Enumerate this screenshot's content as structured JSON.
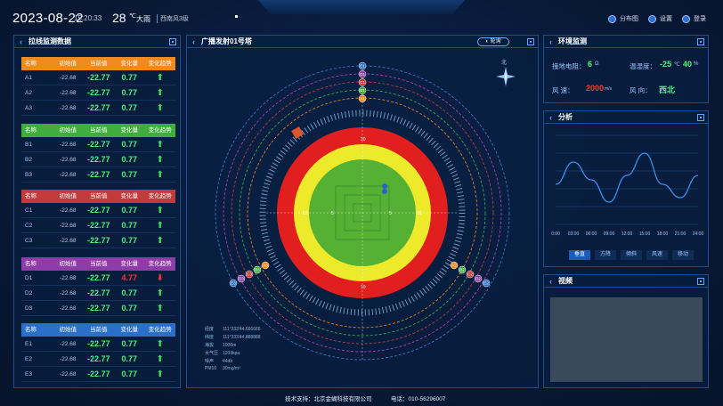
{
  "header": {
    "date": "2023-08-22",
    "time": "15:20:33",
    "temp": "28",
    "temp_unit": "℃",
    "weather": "大雨",
    "wind": "西南风3级",
    "buttons": [
      {
        "label": "分布图",
        "icon": "map-icon"
      },
      {
        "label": "设置",
        "icon": "gear-icon"
      },
      {
        "label": "登录",
        "icon": "user-icon"
      }
    ]
  },
  "left_panel": {
    "title": "拉线监测数据",
    "columns": [
      "名称",
      "初始值",
      "当前值",
      "变化量",
      "变化趋势"
    ],
    "groups": [
      {
        "color": "#f08a1f",
        "rows": [
          {
            "name": "A1",
            "init": "-22.68",
            "cur": "-22.77",
            "delta": "0.77",
            "trend": "up"
          },
          {
            "name": "A2",
            "init": "-22.68",
            "cur": "-22.77",
            "delta": "0.77",
            "trend": "up"
          },
          {
            "name": "A3",
            "init": "-22.68",
            "cur": "-22.77",
            "delta": "0.77",
            "trend": "up"
          }
        ]
      },
      {
        "color": "#3fae3c",
        "rows": [
          {
            "name": "B1",
            "init": "-22.68",
            "cur": "-22.77",
            "delta": "0.77",
            "trend": "up"
          },
          {
            "name": "B2",
            "init": "-22.68",
            "cur": "-22.77",
            "delta": "0.77",
            "trend": "up"
          },
          {
            "name": "B3",
            "init": "-22.68",
            "cur": "-22.77",
            "delta": "0.77",
            "trend": "up"
          }
        ]
      },
      {
        "color": "#c23b3b",
        "rows": [
          {
            "name": "C1",
            "init": "-22.68",
            "cur": "-22.77",
            "delta": "0.77",
            "trend": "up"
          },
          {
            "name": "C2",
            "init": "-22.68",
            "cur": "-22.77",
            "delta": "0.77",
            "trend": "up"
          },
          {
            "name": "C3",
            "init": "-22.68",
            "cur": "-22.77",
            "delta": "0.77",
            "trend": "up"
          }
        ]
      },
      {
        "color": "#8e3ca8",
        "rows": [
          {
            "name": "D1",
            "init": "-22.68",
            "cur": "-22.77",
            "delta": "4.77",
            "trend": "down"
          },
          {
            "name": "D2",
            "init": "-22.68",
            "cur": "-22.77",
            "delta": "0.77",
            "trend": "up"
          },
          {
            "name": "D3",
            "init": "-22.68",
            "cur": "-22.77",
            "delta": "0.77",
            "trend": "up"
          }
        ]
      },
      {
        "color": "#2a6fc9",
        "rows": [
          {
            "name": "E1",
            "init": "-22.68",
            "cur": "-22.77",
            "delta": "0.77",
            "trend": "up"
          },
          {
            "name": "E2",
            "init": "-22.68",
            "cur": "-22.77",
            "delta": "0.77",
            "trend": "up"
          },
          {
            "name": "E3",
            "init": "-22.68",
            "cur": "-22.77",
            "delta": "0.77",
            "trend": "up"
          }
        ]
      }
    ]
  },
  "center_panel": {
    "title": "广播发射01号塔",
    "toggle_label": "轮询",
    "north": "北",
    "markers_top": [
      "E1",
      "D1",
      "C1",
      "B1",
      "A1"
    ],
    "markers_left": [
      "E3",
      "D3",
      "C3",
      "B3",
      "A3"
    ],
    "markers_right": [
      "A2",
      "B2",
      "C2",
      "D2",
      "E2"
    ],
    "info": [
      {
        "k": "经度",
        "v": "111°333'44.666666"
      },
      {
        "k": "纬度",
        "v": "111°333'44.888888"
      },
      {
        "k": "海拔",
        "v": "1000m"
      },
      {
        "k": "大气压",
        "v": "1203kpa"
      },
      {
        "k": "噪声",
        "v": "44db"
      },
      {
        "k": "PM10",
        "v": "30mg/m³"
      }
    ]
  },
  "env_panel": {
    "title": "环境监测",
    "ground_label": "接地电阻：",
    "ground_value": "6",
    "ground_unit": "Ω",
    "temp_label": "温湿度：",
    "temp_value": "-25",
    "temp_unit": "℃",
    "hum_value": "40",
    "hum_unit": "%",
    "wind_speed_label": "风    速：",
    "wind_speed_value": "2000",
    "wind_speed_unit": "m/s",
    "wind_dir_label": "风    向：",
    "wind_dir_value": "西北"
  },
  "analysis_panel": {
    "title": "分析",
    "x_ticks": [
      "0:00",
      "03:00",
      "06:00",
      "09:00",
      "12:00",
      "15:00",
      "18:00",
      "21:00",
      "24:00"
    ],
    "tabs": [
      "垂直",
      "方降",
      "倾斜",
      "风速",
      "移动"
    ]
  },
  "chart_data": {
    "type": "line",
    "categories": [
      "0:00",
      "03:00",
      "06:00",
      "09:00",
      "12:00",
      "15:00",
      "18:00",
      "21:00",
      "24:00"
    ],
    "series": [
      {
        "values": [
          0.45,
          0.7,
          0.5,
          0.25,
          0.55,
          0.8,
          0.45,
          0.3,
          0.55
        ]
      }
    ],
    "grid": true
  },
  "video_panel": {
    "title": "视频"
  },
  "footer": {
    "support": "技术支持：北京金蝴科技有限公司",
    "phone": "电话：010-56296007"
  }
}
